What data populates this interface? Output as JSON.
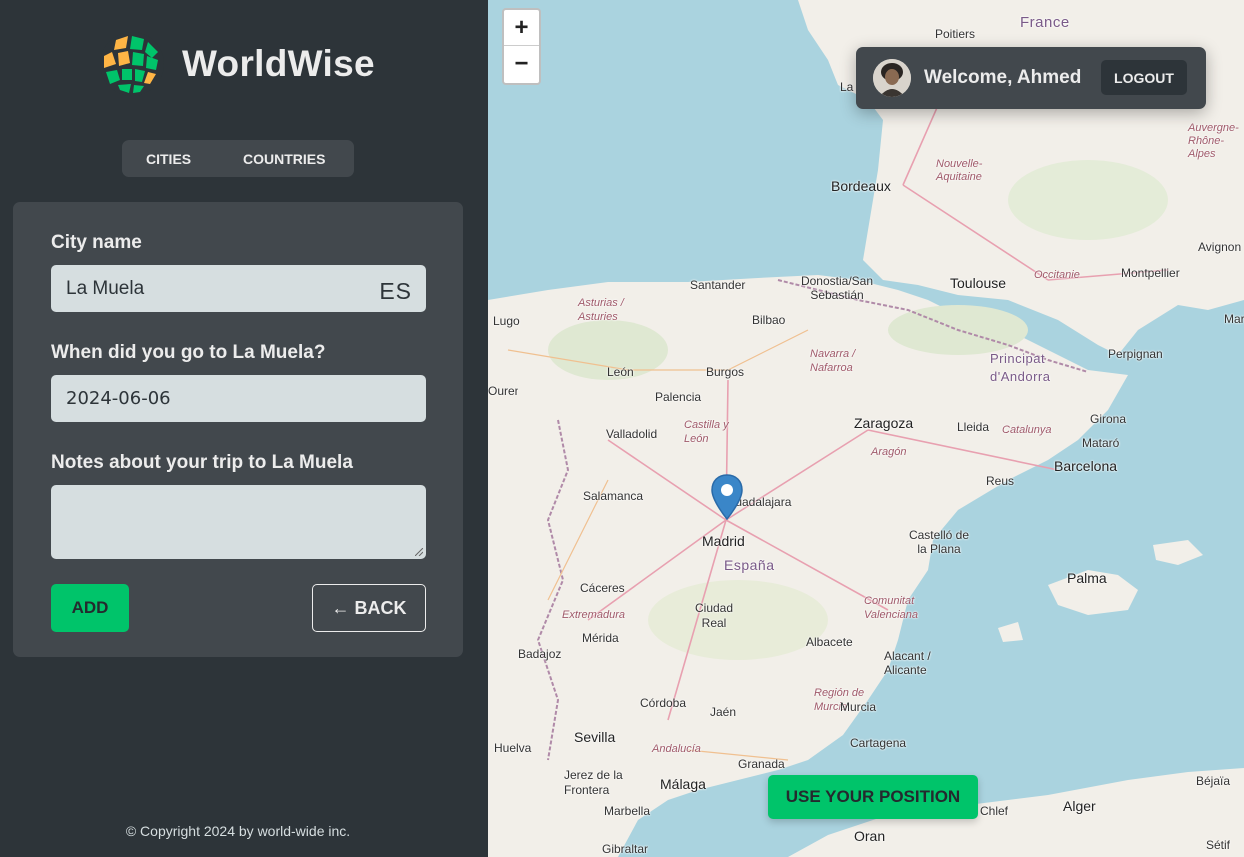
{
  "app": {
    "name": "WorldWise"
  },
  "tabs": {
    "cities": "CITIES",
    "countries": "COUNTRIES"
  },
  "form": {
    "city_label": "City name",
    "city_value": "La Muela",
    "city_flag": "ES",
    "date_label": "When did you go to La Muela?",
    "date_value": "2024-06-06",
    "notes_label": "Notes about your trip to La Muela",
    "notes_value": "",
    "add_label": "ADD",
    "back_label": "← BACK"
  },
  "footer": {
    "copyright": "© Copyright 2024 by world-wide inc."
  },
  "map": {
    "zoom_in": "+",
    "zoom_out": "−",
    "use_position_label": "USE YOUR POSITION",
    "places": [
      "France",
      "Poitiers",
      "La",
      "Bordeaux",
      "Nouvelle-Aquitaine",
      "Auvergne-Rhône-Alpes",
      "Toulouse",
      "Occitanie",
      "Avignon",
      "Montpellier",
      "Marseille",
      "Perpignan",
      "Principat d'Andorra",
      "Donostia/San Sebastián",
      "Santander",
      "Asturias / Asturies",
      "Lugo",
      "Bilbao",
      "Navarra / Nafarroa",
      "León",
      "Burgos",
      "Palencia",
      "Castilla y León",
      "Valladolid",
      "Zaragoza",
      "Lleida",
      "Catalunya",
      "Girona",
      "Mataró",
      "Barcelona",
      "Aragón",
      "Reus",
      "Salamanca",
      "Guadalajara",
      "Madrid",
      "España",
      "Castelló de la Plana",
      "Palma",
      "Cáceres",
      "Extremadura",
      "Mérida",
      "Ciudad Real",
      "Comunitat Valenciana",
      "Albacete",
      "Alacant / Alicante",
      "Badajoz",
      "Región de Murcia",
      "Murcia",
      "Córdoba",
      "Jaén",
      "Sevilla",
      "Andalucía",
      "Huelva",
      "Cartagena",
      "Granada",
      "Jerez de la Frontera",
      "Málaga",
      "Marbella",
      "Gibraltar",
      "Oran",
      "Chlef",
      "Alger",
      "Béjaïa",
      "Sétif",
      "Ourense"
    ]
  },
  "user": {
    "welcome": "Welcome, Ahmed",
    "logout_label": "LOGOUT"
  },
  "colors": {
    "brand_green": "#00c46a",
    "dark_1": "#2d3439",
    "dark_2": "#42484d",
    "light_3": "#d6dee0"
  }
}
